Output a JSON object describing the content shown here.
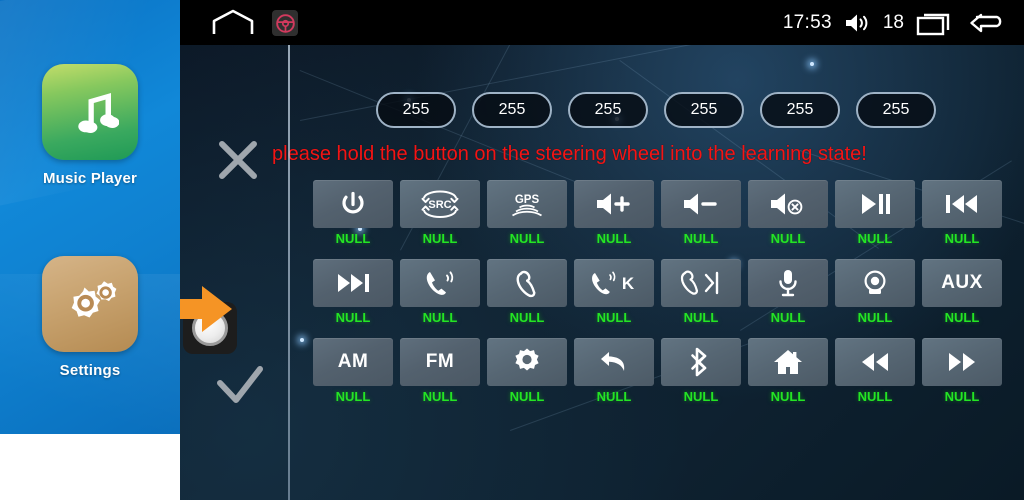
{
  "launcher": {
    "apps": [
      {
        "label": "Music Player",
        "icon": "music-note-icon"
      },
      {
        "label": "Settings",
        "icon": "gears-icon"
      }
    ]
  },
  "statusbar": {
    "home_icon": "home-outline-icon",
    "steering_wheel_icon": "steering-wheel-icon",
    "clock": "17:53",
    "speaker_icon": "volume-speaker-icon",
    "volume_value": "18",
    "recents_icon": "recents-icon",
    "back_icon": "back-arrow-icon"
  },
  "controls": {
    "cancel_icon": "close-x-icon",
    "confirm_icon": "check-icon",
    "knob_icon": "rotary-knob-icon",
    "pointer_icon": "orange-arrow-icon"
  },
  "values": {
    "pills": [
      "255",
      "255",
      "255",
      "255",
      "255",
      "255"
    ]
  },
  "message": {
    "warning": "please hold the button on the steering wheel into the learning state!",
    "warning_color": "#f41414"
  },
  "grid": {
    "assigned_label": "NULL",
    "label_color": "#24e524",
    "rows": [
      [
        {
          "icon": "power-icon",
          "text": "",
          "label": "NULL"
        },
        {
          "icon": "src-icon",
          "text": "SRC",
          "label": "NULL"
        },
        {
          "icon": "gps-icon",
          "text": "GPS",
          "label": "NULL"
        },
        {
          "icon": "volume-up-icon",
          "text": "",
          "label": "NULL"
        },
        {
          "icon": "volume-down-icon",
          "text": "",
          "label": "NULL"
        },
        {
          "icon": "volume-mute-icon",
          "text": "",
          "label": "NULL"
        },
        {
          "icon": "play-pause-icon",
          "text": "",
          "label": "NULL"
        },
        {
          "icon": "previous-track-icon",
          "text": "",
          "label": "NULL"
        }
      ],
      [
        {
          "icon": "next-track-icon",
          "text": "",
          "label": "NULL"
        },
        {
          "icon": "answer-call-icon",
          "text": "",
          "label": "NULL"
        },
        {
          "icon": "end-call-icon",
          "text": "",
          "label": "NULL"
        },
        {
          "icon": "call-k-icon",
          "text": "K",
          "label": "NULL"
        },
        {
          "icon": "end-call-next-icon",
          "text": "",
          "label": "NULL"
        },
        {
          "icon": "microphone-icon",
          "text": "",
          "label": "NULL"
        },
        {
          "icon": "camera-icon",
          "text": "",
          "label": "NULL"
        },
        {
          "icon": "aux-icon",
          "text": "AUX",
          "label": "NULL"
        }
      ],
      [
        {
          "icon": "am-icon",
          "text": "AM",
          "label": "NULL"
        },
        {
          "icon": "fm-icon",
          "text": "FM",
          "label": "NULL"
        },
        {
          "icon": "settings-gear-icon",
          "text": "",
          "label": "NULL"
        },
        {
          "icon": "back-curve-icon",
          "text": "",
          "label": "NULL"
        },
        {
          "icon": "bluetooth-icon",
          "text": "",
          "label": "NULL"
        },
        {
          "icon": "home-icon",
          "text": "",
          "label": "NULL"
        },
        {
          "icon": "rewind-icon",
          "text": "",
          "label": "NULL"
        },
        {
          "icon": "fast-forward-icon",
          "text": "",
          "label": "NULL"
        }
      ]
    ]
  }
}
